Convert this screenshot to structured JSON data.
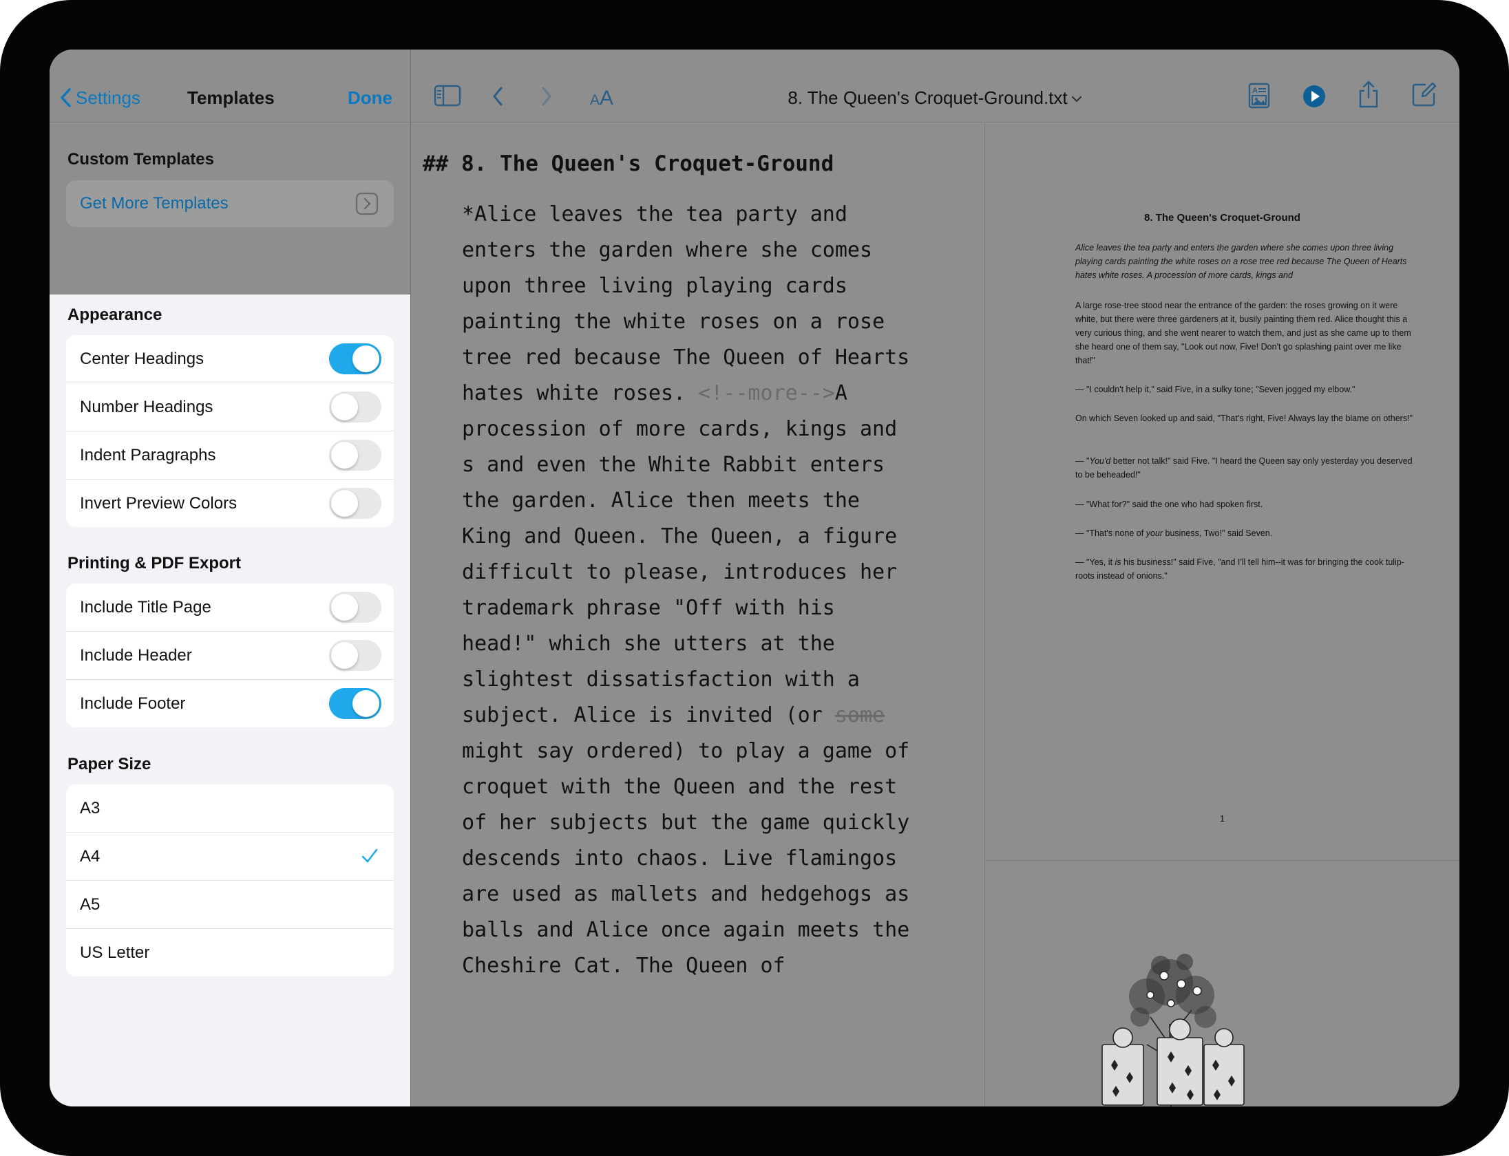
{
  "sidebar": {
    "back_label": "Settings",
    "title": "Templates",
    "done_label": "Done",
    "custom_templates_header": "Custom Templates",
    "get_more_label": "Get More Templates",
    "appearance_header": "Appearance",
    "appearance": [
      {
        "label": "Center Headings",
        "on": true
      },
      {
        "label": "Number Headings",
        "on": false
      },
      {
        "label": "Indent Paragraphs",
        "on": false
      },
      {
        "label": "Invert Preview Colors",
        "on": false
      }
    ],
    "printing_header": "Printing & PDF Export",
    "printing": [
      {
        "label": "Include Title Page",
        "on": false
      },
      {
        "label": "Include Header",
        "on": false
      },
      {
        "label": "Include Footer",
        "on": true
      }
    ],
    "paper_header": "Paper Size",
    "paper_sizes": [
      {
        "label": "A3",
        "selected": false
      },
      {
        "label": "A4",
        "selected": true
      },
      {
        "label": "A5",
        "selected": false
      },
      {
        "label": "US Letter",
        "selected": false
      }
    ]
  },
  "toolbar": {
    "document_title": "8. The Queen's Croquet-Ground.txt",
    "icons": [
      "sidebar-icon",
      "back-chevron-icon",
      "forward-chevron-icon",
      "font-size-icon",
      "templates-icon",
      "play-icon",
      "share-icon",
      "compose-icon"
    ]
  },
  "editor": {
    "heading": "## 8. The Queen's Croquet-Ground",
    "p_a": "*Alice leaves the tea party and enters the garden where she comes upon three living playing cards painting the white roses on a rose tree red because The Queen of Hearts hates white roses. ",
    "comment": "<!--more-->",
    "p_b": "A procession of more cards, kings and",
    "p_c": "s and even the White Rabbit enters the garden. Alice then meets the King and Queen. The Queen, a figure difficult to please, introduces her trademark phrase \"Off with his head!\" which she utters at the slightest dissatisfaction with a subject. Alice is invited (or ",
    "strike": "some",
    "p_d": " might say ordered) to play a game of croquet with the Queen and the rest of her subjects but the game quickly descends into chaos. Live flamingos are used as mallets and hedgehogs as balls and Alice once again meets the Cheshire Cat. The Queen of"
  },
  "preview": {
    "title": "8. The Queen's Croquet-Ground",
    "intro": "Alice leaves the tea party and enters the garden where she comes upon three living playing cards painting the white roses on a rose tree red because The Queen of Hearts hates white roses. A procession of more cards, kings and",
    "p1": "A large rose-tree stood near the entrance of the garden: the roses growing on it were white, but there were three gardeners at it, busily painting them red. Alice thought this a very curious thing, and she went nearer to watch them, and just as she came up to them she heard one of them say, \"Look out now, Five! Don't go splashing paint over me like that!\"",
    "p2": "— \"I couldn't help it,\" said Five, in a sulky tone; \"Seven jogged my elbow.\"",
    "p3": "On which Seven looked up and said, \"That's right, Five! Always lay the blame on others!\"",
    "p4_a": "— \"",
    "p4_em": "You'd",
    "p4_b": " better not talk!\" said Five. \"I heard the Queen say only yesterday you deserved to be beheaded!\"",
    "p5": "— \"What for?\" said the one who had spoken first.",
    "p6_a": "— \"That's none of ",
    "p6_em": "your",
    "p6_b": " business, Two!\" said Seven.",
    "p7_a": "— \"Yes, it ",
    "p7_em": "is",
    "p7_b": " his business!\" said Five, \"and I'll tell him--it was for bringing the cook tulip-roots instead of onions.\"",
    "page_number": "1"
  },
  "colors": {
    "accent": "#1fa9ea",
    "link": "#0a79c2",
    "dim": "#8e8e8e"
  }
}
